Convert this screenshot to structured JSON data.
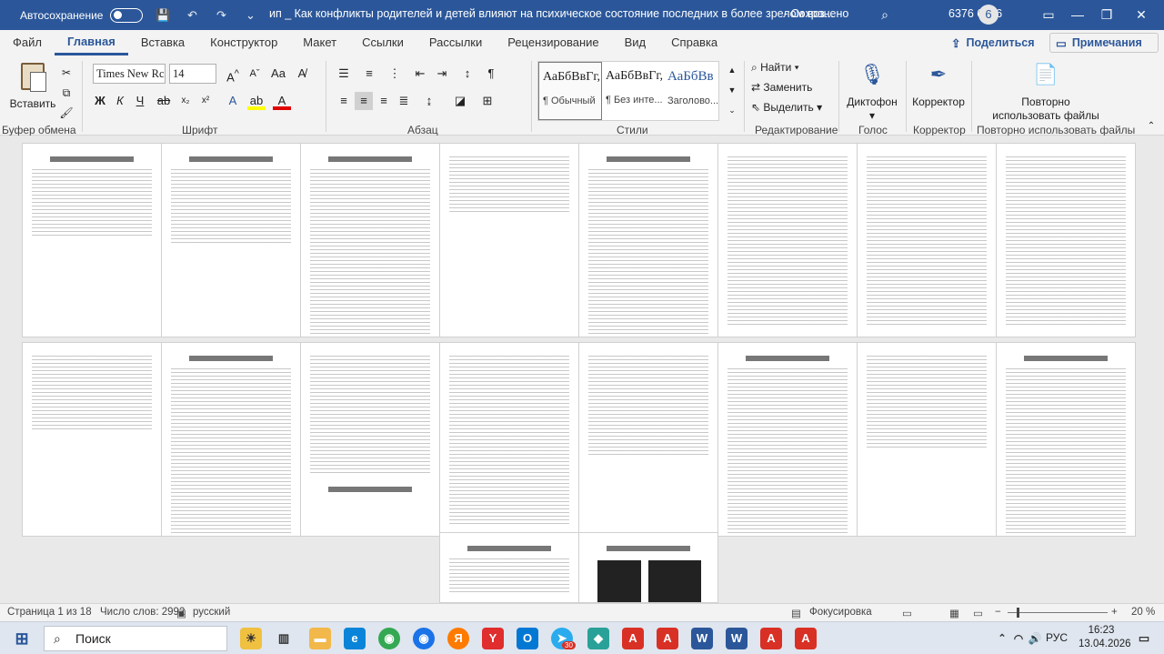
{
  "titlebar": {
    "autosave_label": "Автосохранение",
    "doc_title": "ип _ Как конфликты родителей и детей влияют на психическое состояние последних в более зрелом воз...",
    "saved_state": "- Сохранено",
    "user_name": "6376 6376",
    "icons": [
      "save-icon",
      "undo-icon",
      "redo-icon",
      "customize-icon"
    ]
  },
  "tabs": [
    "Файл",
    "Главная",
    "Вставка",
    "Конструктор",
    "Макет",
    "Ссылки",
    "Рассылки",
    "Рецензирование",
    "Вид",
    "Справка"
  ],
  "active_tab": "Главная",
  "share_label": "Поделиться",
  "notes_label": "Примечания",
  "ribbon": {
    "paste_label": "Вставить",
    "clipboard_label": "Буфер обмена",
    "font_label": "Шрифт",
    "font_name": "Times New Rc",
    "font_size": "14",
    "paragraph_label": "Абзац",
    "styles_label": "Стили",
    "styles": [
      {
        "sample": "АаБбВвГг,",
        "name": "¶ Обычный"
      },
      {
        "sample": "АаБбВвГг,",
        "name": "¶ Без инте..."
      },
      {
        "sample": "АаБбВв",
        "name": "Заголово..."
      }
    ],
    "editing_label": "Редактирование",
    "find_label": "Найти",
    "replace_label": "Заменить",
    "select_label": "Выделить",
    "dictation_label": "Диктофон",
    "voice_label": "Голос",
    "editor_label": "Корректор",
    "editor_group_label": "Корректор",
    "reuse_label": "Повторно использовать файлы",
    "reuse_group_label": "Повторно использовать файлы"
  },
  "statusbar": {
    "page_info": "Страница 1 из 18",
    "word_count": "Число слов: 2992",
    "language": "русский",
    "focus_label": "Фокусировка",
    "zoom": "20 %"
  },
  "taskbar": {
    "search_placeholder": "Поиск",
    "badge": "30",
    "language": "РУС",
    "time": "16:23",
    "date": "13.04.2026"
  },
  "colors": {
    "accent": "#2b579a",
    "pdf_red": "#d93025"
  }
}
